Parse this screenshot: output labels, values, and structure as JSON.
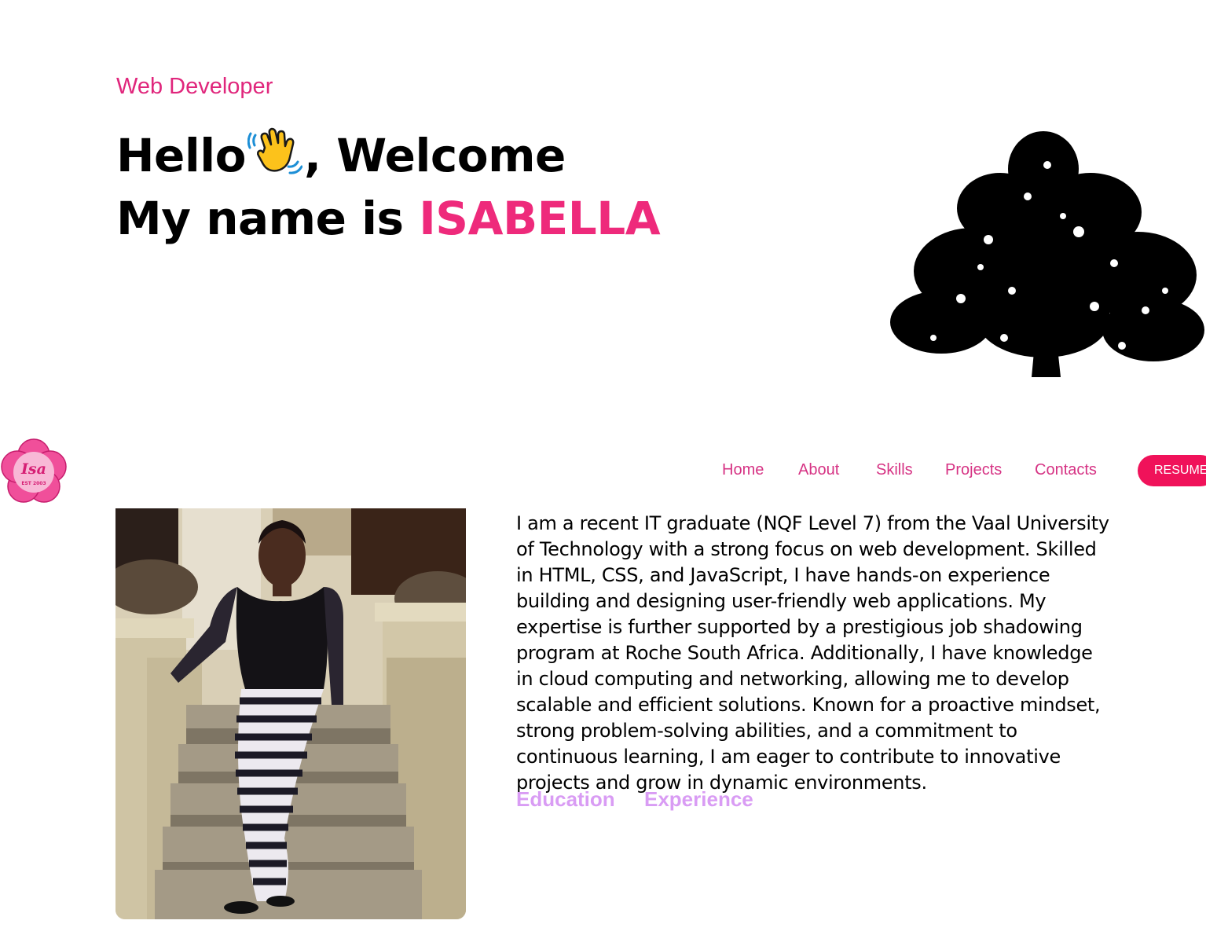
{
  "hero": {
    "subtitle": "Web Developer",
    "greeting": "Hello",
    "greeting_suffix": ", Welcome",
    "name_prefix": "My name is ",
    "name": "ISABELLA"
  },
  "icons": {
    "wave": "waving-hand-icon",
    "tree": "tree-silhouette-icon",
    "logo": "flower-logo-icon"
  },
  "logo": {
    "text": "Isa",
    "sub": "EST 2003"
  },
  "nav": {
    "items": [
      "Home",
      "About",
      "Skills",
      "Projects",
      "Contacts"
    ],
    "resume_label": "RESUME"
  },
  "about": {
    "bio": "I am a recent IT graduate (NQF Level 7) from the Vaal University of Technology with a strong focus on web development. Skilled in HTML, CSS, and JavaScript, I have hands-on experience building and designing user-friendly web applications. My expertise is further supported by a prestigious job shadowing program at Roche South Africa. Additionally, I have knowledge in cloud computing and networking, allowing me to develop scalable and efficient solutions. Known for a proactive mindset, strong problem-solving abilities, and a commitment to continuous learning, I am eager to contribute to innovative projects and grow in dynamic environments.",
    "tabs": [
      "Education",
      "Experience"
    ]
  },
  "colors": {
    "accent": "#ee2a7b",
    "nav_link": "#d63384",
    "resume_bg": "#f0125a",
    "tab_color": "#d99cf4"
  }
}
